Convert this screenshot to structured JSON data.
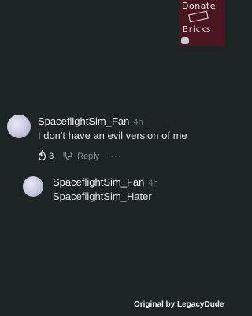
{
  "badge": {
    "line1": "Donate",
    "line2": "Bricks"
  },
  "comment": {
    "author": "SpaceflightSim_Fan",
    "time": "4h",
    "text": "I don't have an evil version of me",
    "likes": "3",
    "reply_label": "Reply",
    "more_label": "···"
  },
  "reply": {
    "author": "SpaceflightSim_Fan",
    "time": "4h",
    "text": "SpaceflightSim_Hater"
  },
  "credit": "Original by LegacyDude",
  "icons": {
    "like": "flame-icon",
    "dislike": "thumbs-down-icon"
  }
}
